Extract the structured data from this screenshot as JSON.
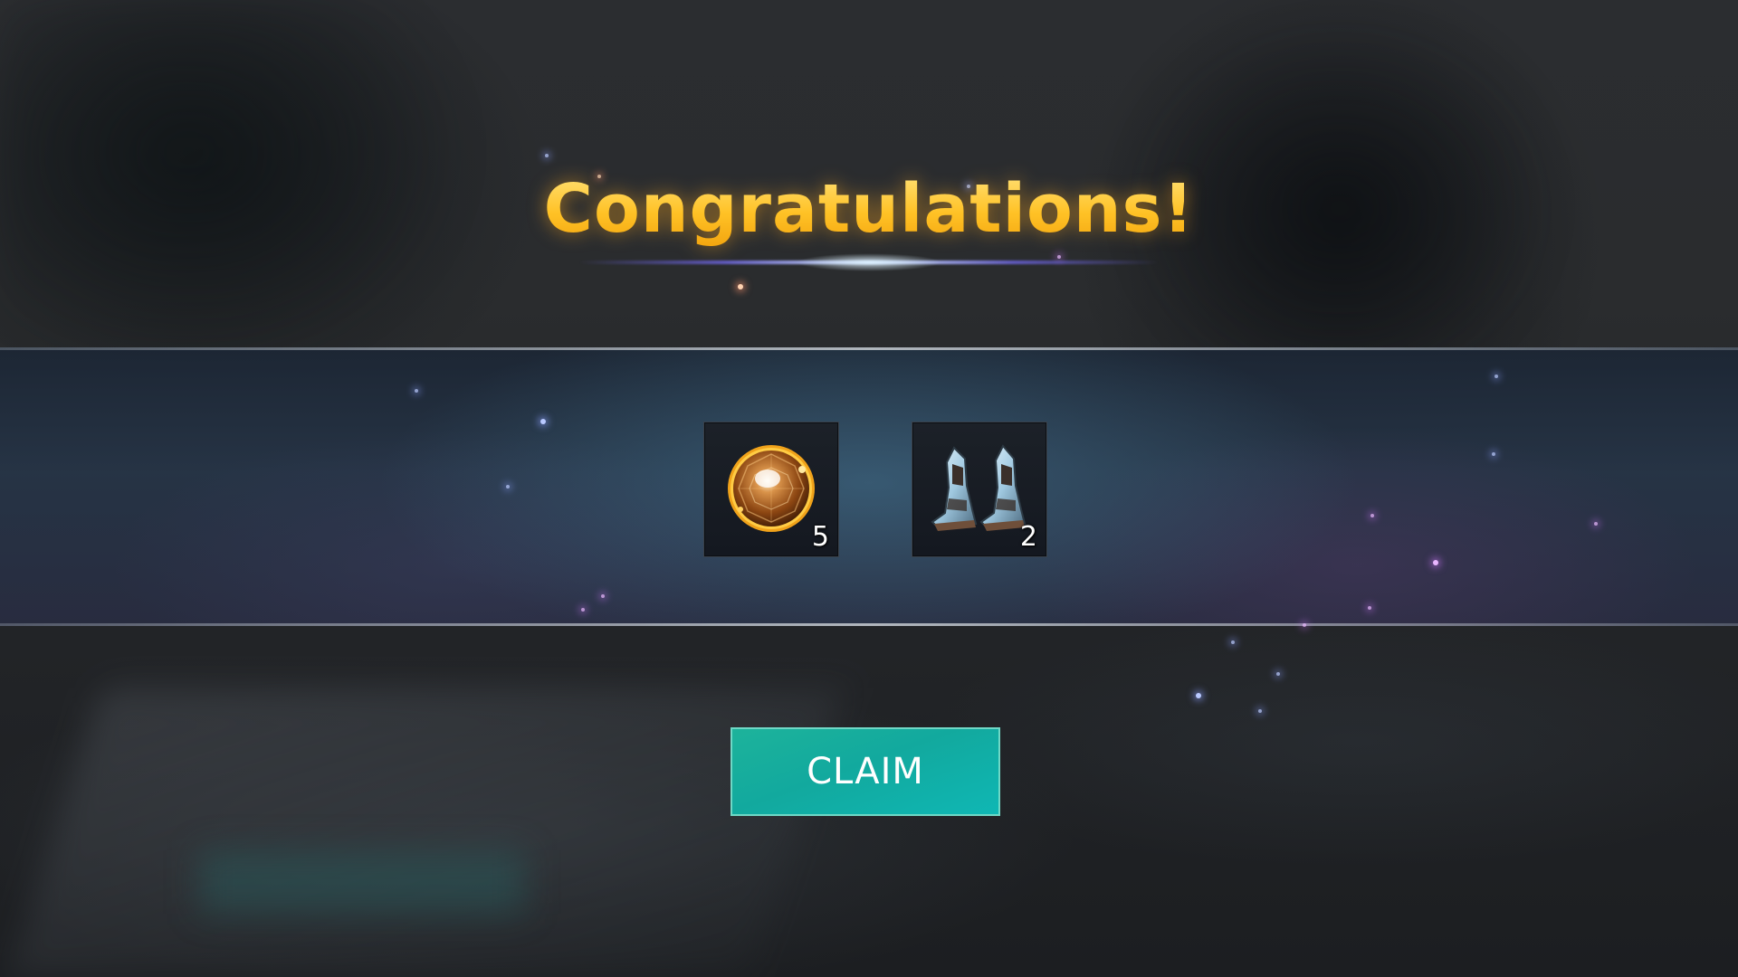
{
  "screen": {
    "title": "Congratulations!"
  },
  "rewards": [
    {
      "name": "amber-gem",
      "icon": "amber-gem-icon",
      "quantity": "5"
    },
    {
      "name": "armored-boots",
      "icon": "armored-boots-icon",
      "quantity": "2"
    }
  ],
  "actions": {
    "claim_label": "CLAIM"
  },
  "colors": {
    "title": "#ffc93a",
    "claim_button": "#12a99e",
    "band": "#26344a"
  }
}
